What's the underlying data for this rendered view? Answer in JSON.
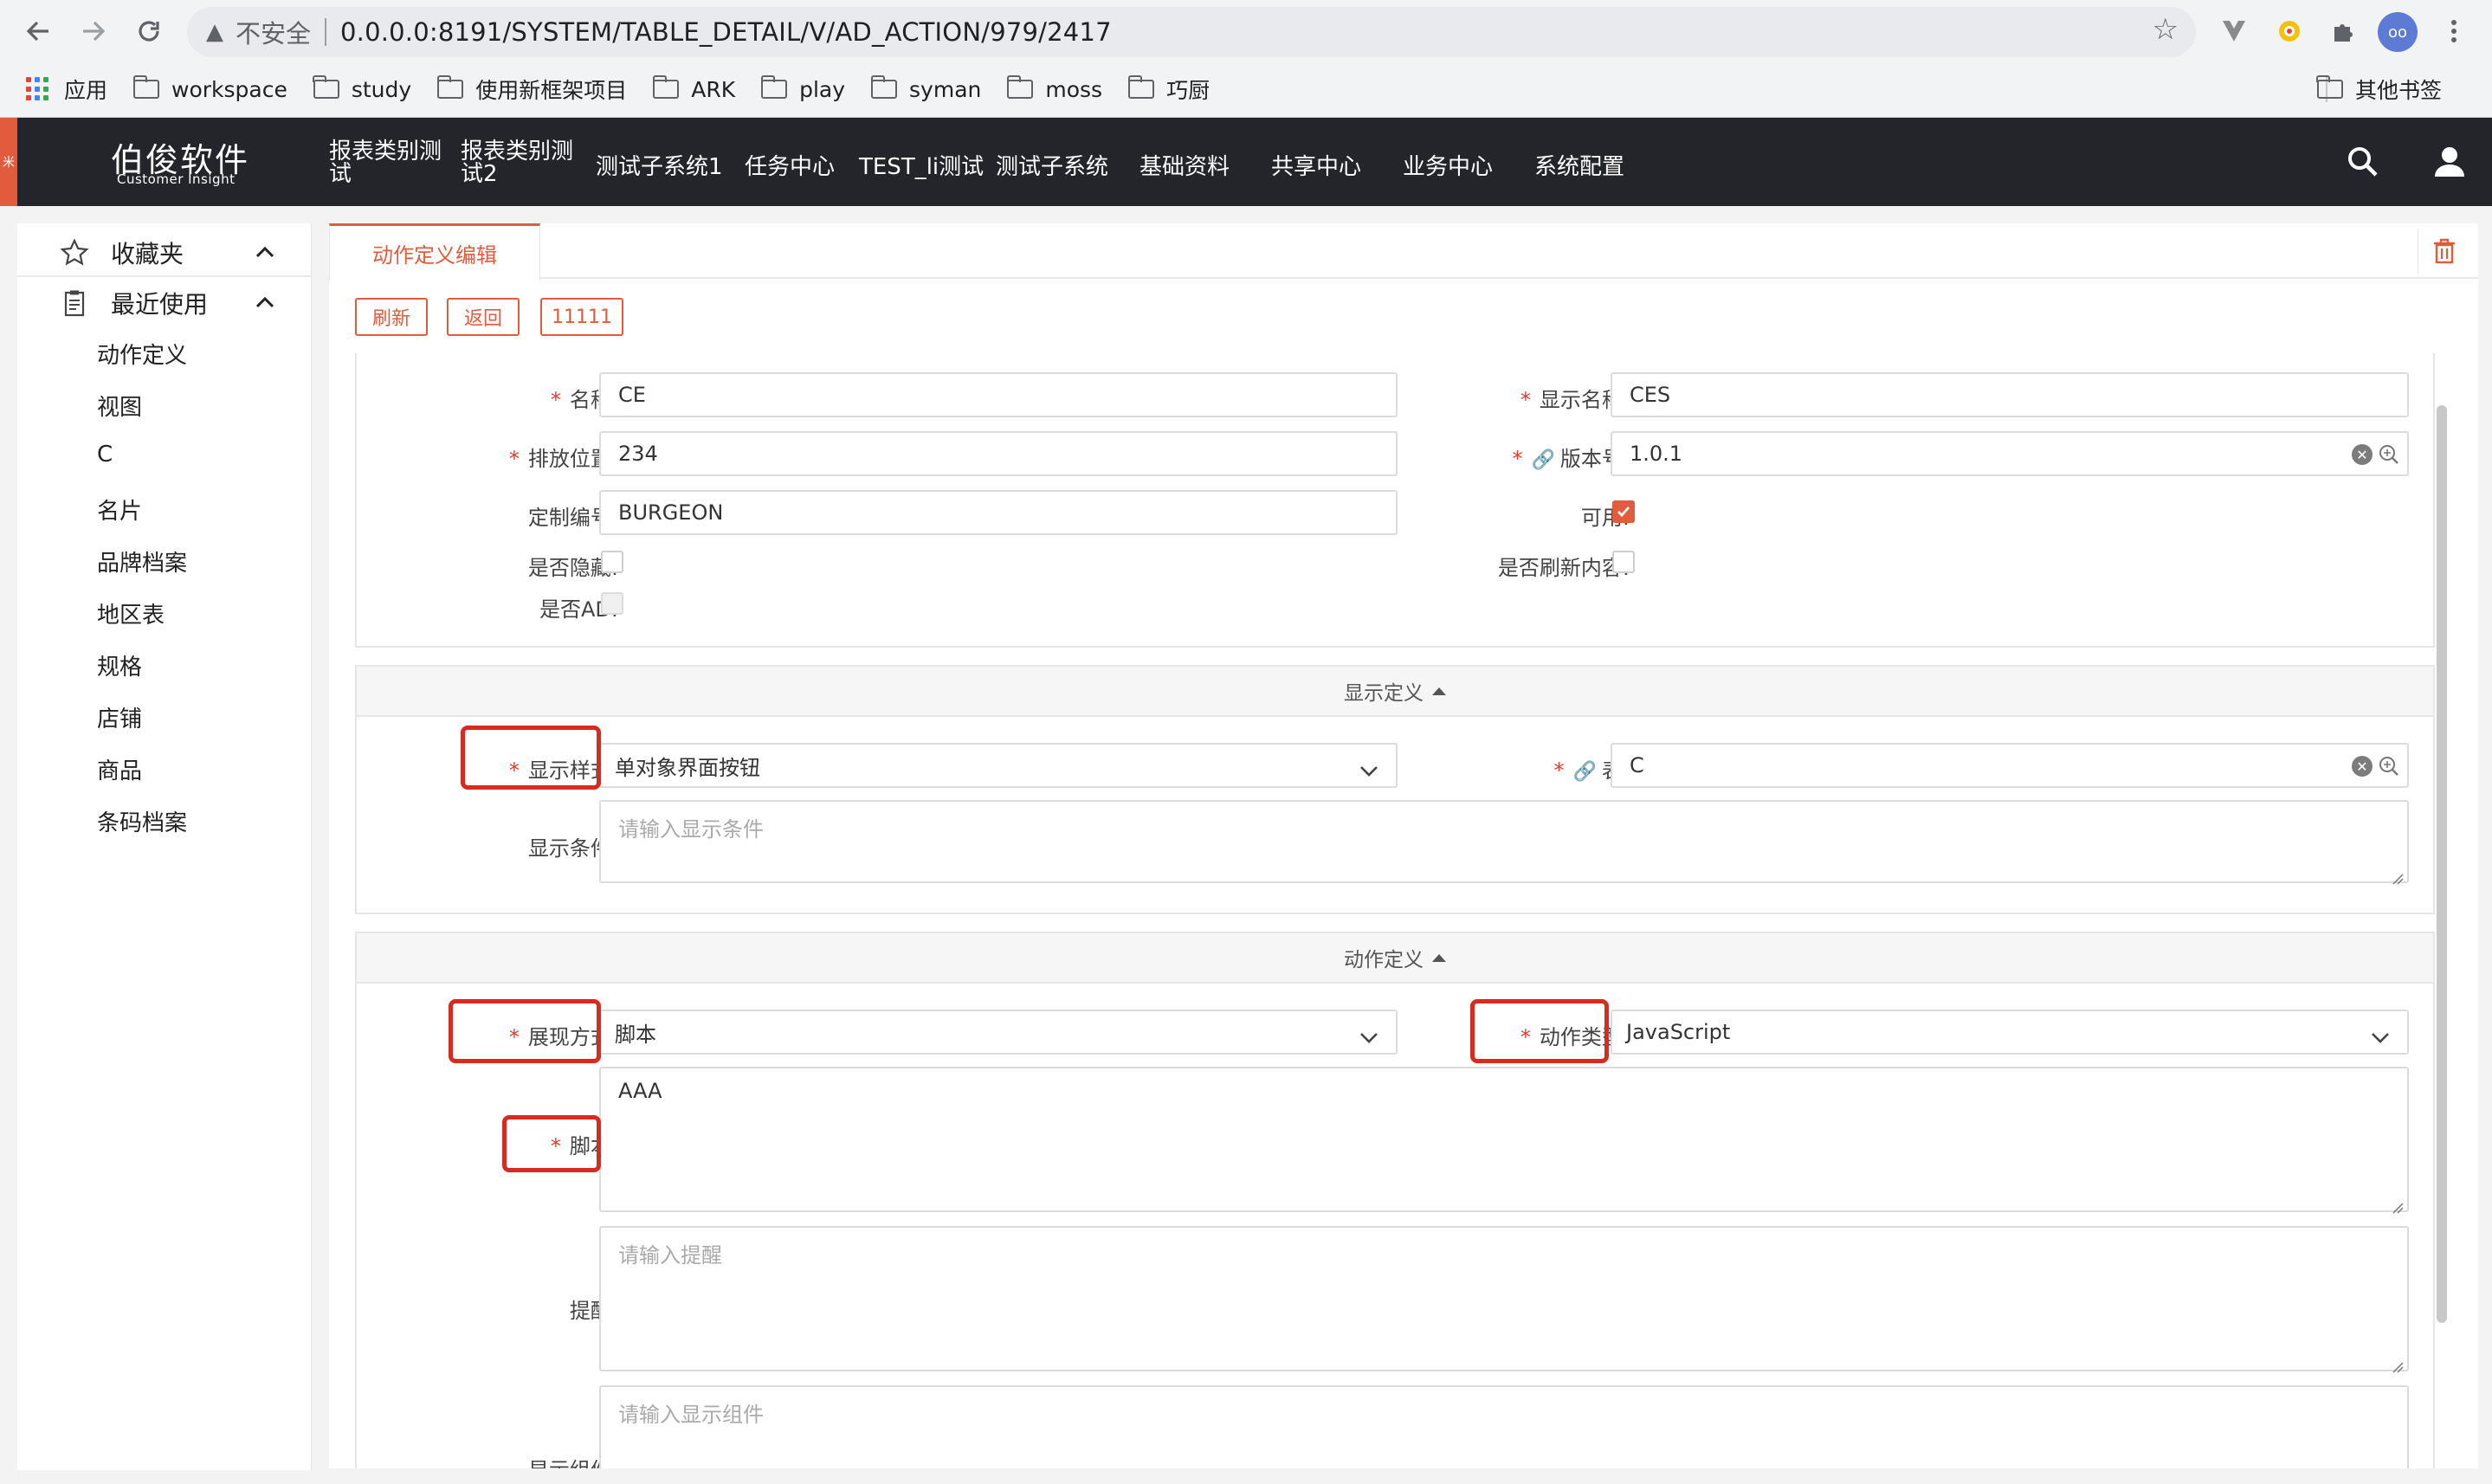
{
  "browser": {
    "insecure_label": "不安全",
    "url": "0.0.0.0:8191/SYSTEM/TABLE_DETAIL/V/AD_ACTION/979/2417",
    "bookmarks": [
      "应用",
      "workspace",
      "study",
      "使用新框架项目",
      "ARK",
      "play",
      "syman",
      "moss",
      "巧厨"
    ],
    "other_bookmarks": "其他书签"
  },
  "header": {
    "logo_title": "伯俊软件",
    "logo_subtitle": "Customer Insight",
    "side_tab": "米",
    "menu": [
      "报表类别测试",
      "报表类别测试2",
      "测试子系统1",
      "任务中心",
      "TEST_li测试",
      "测试子系统",
      "基础资料",
      "共享中心",
      "业务中心",
      "系统配置"
    ]
  },
  "sidebar": {
    "favorites": "收藏夹",
    "recent": "最近使用",
    "items": [
      "动作定义",
      "视图",
      "C",
      "名片",
      "品牌档案",
      "地区表",
      "规格",
      "店铺",
      "商品",
      "条码档案"
    ]
  },
  "tab": {
    "title": "动作定义编辑"
  },
  "toolbar": {
    "refresh": "刷新",
    "back": "返回",
    "custom": "11111"
  },
  "form": {
    "name_label": "名称:",
    "name_value": "CE",
    "display_name_label": "显示名称:",
    "display_name_value": "CES",
    "order_label": "排放位置:",
    "order_value": "234",
    "version_label": "版本号:",
    "version_value": "1.0.1",
    "custom_no_label": "定制编号:",
    "custom_no_value": "BURGEON",
    "enabled_label": "可用:",
    "hidden_label": "是否隐藏:",
    "refresh_content_label": "是否刷新内容:",
    "is_ad_label": "是否AD:"
  },
  "display_section": {
    "title": "显示定义",
    "style_label": "显示样式:",
    "style_value": "单对象界面按钮",
    "table_label": "表:",
    "table_value": "C",
    "condition_label": "显示条件:",
    "condition_placeholder": "请输入显示条件"
  },
  "action_section": {
    "title": "动作定义",
    "present_label": "展现方式:",
    "present_value": "脚本",
    "action_type_label": "动作类型:",
    "action_type_value": "JavaScript",
    "script_label": "脚本:",
    "script_value": "AAA",
    "reminder_label": "提醒:",
    "reminder_placeholder": "请输入提醒",
    "component_label": "显示组件:",
    "component_placeholder": "请输入显示组件"
  },
  "colors": {
    "accent": "#e25b3c",
    "header_bg": "#23252b",
    "highlight": "#d92a20",
    "required": "#e63b2a"
  }
}
